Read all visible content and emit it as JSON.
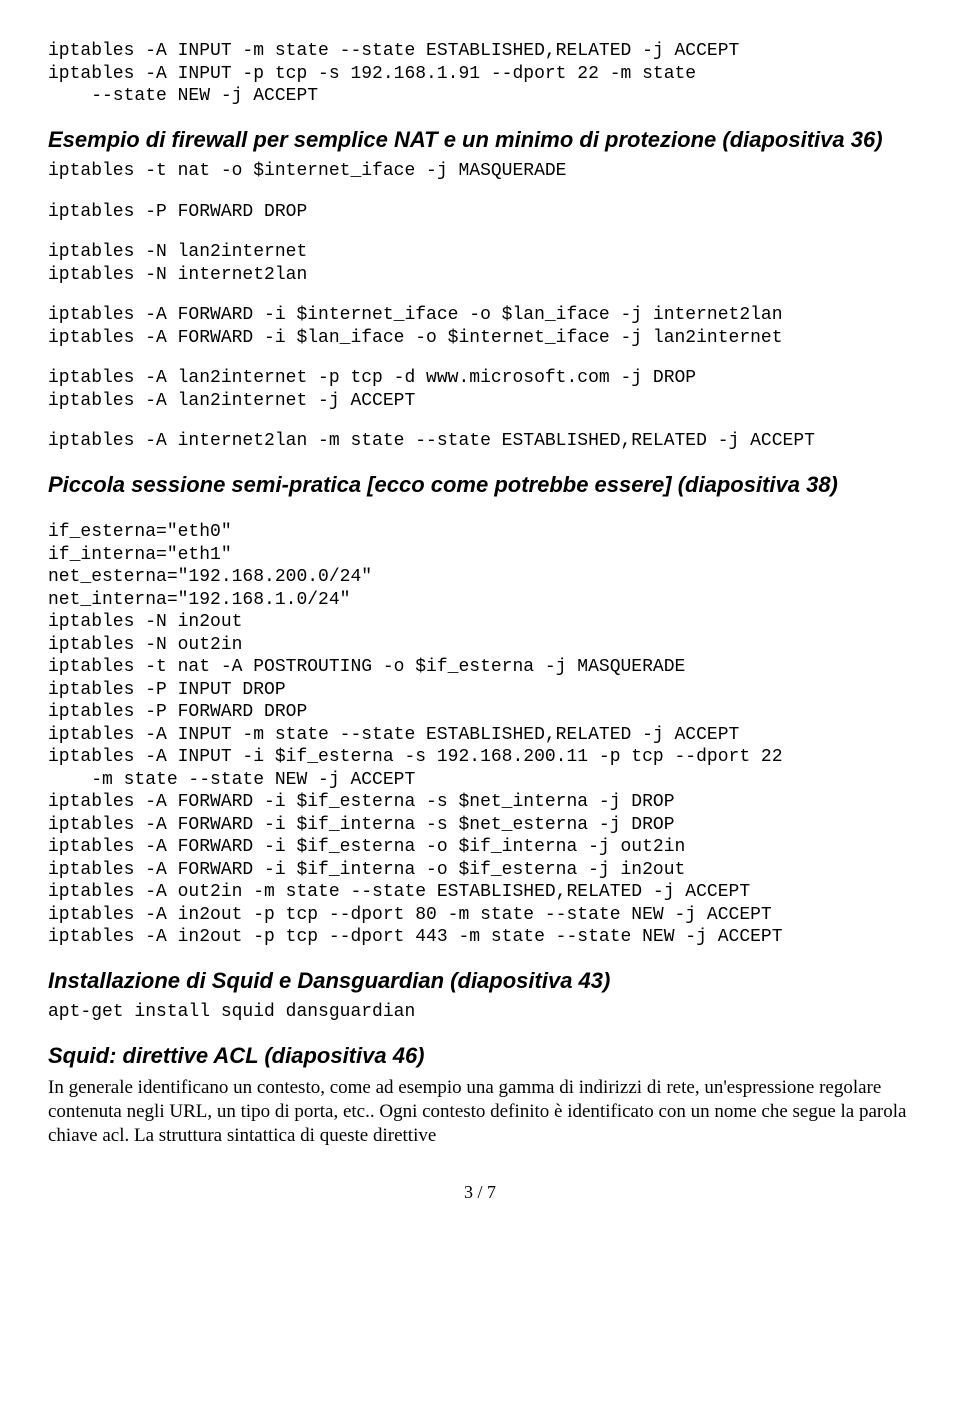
{
  "block1": "iptables -A INPUT -m state --state ESTABLISHED,RELATED -j ACCEPT\niptables -A INPUT -p tcp -s 192.168.1.91 --dport 22 -m state\n    --state NEW -j ACCEPT",
  "heading1": "Esempio di firewall per semplice NAT e un minimo di protezione (diapositiva 36)",
  "block2a": "iptables -t nat -o $internet_iface -j MASQUERADE",
  "block2b": "iptables -P FORWARD DROP",
  "block2c": "iptables -N lan2internet\niptables -N internet2lan",
  "block2d": "iptables -A FORWARD -i $internet_iface -o $lan_iface -j internet2lan\niptables -A FORWARD -i $lan_iface -o $internet_iface -j lan2internet",
  "block2e": "iptables -A lan2internet -p tcp -d www.microsoft.com -j DROP\niptables -A lan2internet -j ACCEPT",
  "block2f": "iptables -A internet2lan -m state --state ESTABLISHED,RELATED -j ACCEPT",
  "heading2": "Piccola sessione semi-pratica [ecco come potrebbe essere] (diapositiva 38)",
  "block3": "if_esterna=\"eth0\"\nif_interna=\"eth1\"\nnet_esterna=\"192.168.200.0/24\"\nnet_interna=\"192.168.1.0/24\"\niptables -N in2out\niptables -N out2in\niptables -t nat -A POSTROUTING -o $if_esterna -j MASQUERADE\niptables -P INPUT DROP\niptables -P FORWARD DROP\niptables -A INPUT -m state --state ESTABLISHED,RELATED -j ACCEPT\niptables -A INPUT -i $if_esterna -s 192.168.200.11 -p tcp --dport 22\n    -m state --state NEW -j ACCEPT\niptables -A FORWARD -i $if_esterna -s $net_interna -j DROP\niptables -A FORWARD -i $if_interna -s $net_esterna -j DROP\niptables -A FORWARD -i $if_esterna -o $if_interna -j out2in\niptables -A FORWARD -i $if_interna -o $if_esterna -j in2out\niptables -A out2in -m state --state ESTABLISHED,RELATED -j ACCEPT\niptables -A in2out -p tcp --dport 80 -m state --state NEW -j ACCEPT\niptables -A in2out -p tcp --dport 443 -m state --state NEW -j ACCEPT",
  "heading3": "Installazione di Squid e Dansguardian (diapositiva 43)",
  "block4": "apt-get install squid dansguardian",
  "heading4": "Squid: direttive ACL (diapositiva 46)",
  "body1": "In generale identificano un contesto, come ad esempio una gamma di indirizzi di rete, un'espressione regolare contenuta negli URL, un tipo di porta, etc.. Ogni contesto definito è identificato con un nome che segue la parola chiave acl. La struttura sintattica di queste direttive",
  "pageNum": "3 / 7"
}
